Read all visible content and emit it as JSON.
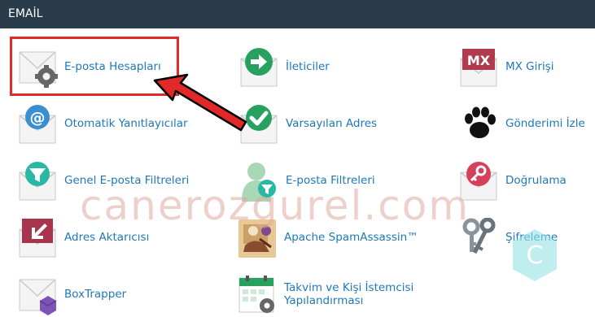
{
  "section": {
    "title": "EMAİL"
  },
  "items": [
    {
      "label": "E-posta Hesapları",
      "icon": "envelope-gear-icon"
    },
    {
      "label": "İleticiler",
      "icon": "envelope-forward-arrow-icon"
    },
    {
      "label": "MX Girişi",
      "icon": "envelope-mx-icon"
    },
    {
      "label": "Otomatik Yanıtlayıcılar",
      "icon": "envelope-at-sign-icon"
    },
    {
      "label": "Varsayılan Adres",
      "icon": "envelope-checkmark-icon"
    },
    {
      "label": "Gönderimi İzle",
      "icon": "paw-print-icon"
    },
    {
      "label": "Genel E-posta Filtreleri",
      "icon": "envelope-funnel-icon"
    },
    {
      "label": "E-posta Filtreleri",
      "icon": "user-funnel-icon"
    },
    {
      "label": "Doğrulama",
      "icon": "envelope-key-icon"
    },
    {
      "label": "Adres Aktarıcısı",
      "icon": "envelope-import-arrow-icon"
    },
    {
      "label": "Apache SpamAssassin™",
      "icon": "spamassassin-icon"
    },
    {
      "label": "Şifreleme",
      "icon": "keys-icon"
    },
    {
      "label": "BoxTrapper",
      "icon": "envelope-box-icon"
    },
    {
      "label": "Takvim ve Kişi İstemcisi Yapılandırması",
      "icon": "calendar-gear-icon"
    }
  ],
  "watermark": {
    "text": "canerozgurel.com",
    "badge_letter": "C"
  },
  "colors": {
    "header_bg": "#293a4a",
    "link": "#1e78b8",
    "accent_green": "#27a060",
    "accent_red": "#e32828",
    "accent_maroon": "#b03a4e"
  }
}
